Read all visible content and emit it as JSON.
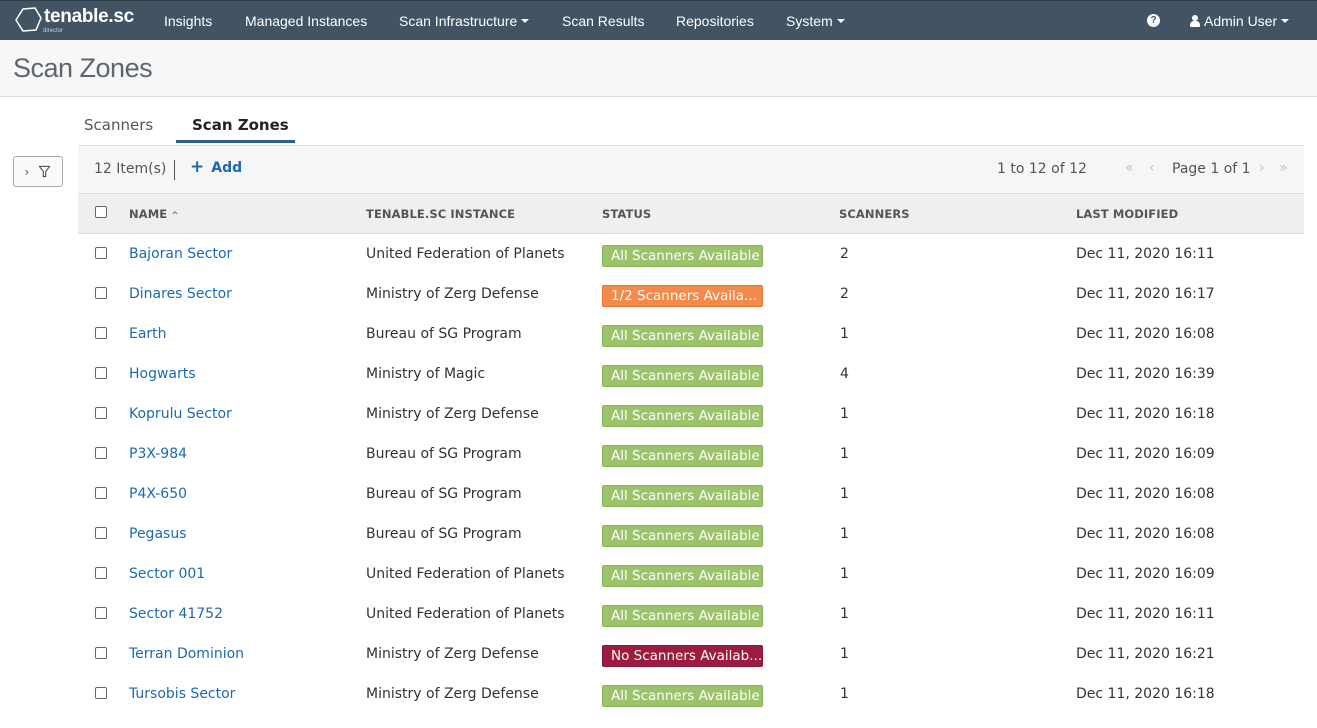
{
  "app": {
    "logo_text": "tenable.sc",
    "logo_sub": "director"
  },
  "nav": {
    "items": [
      {
        "label": "Insights",
        "dropdown": false
      },
      {
        "label": "Managed Instances",
        "dropdown": false
      },
      {
        "label": "Scan Infrastructure",
        "dropdown": true
      },
      {
        "label": "Scan Results",
        "dropdown": false
      },
      {
        "label": "Repositories",
        "dropdown": false
      },
      {
        "label": "System",
        "dropdown": true
      }
    ],
    "help_icon": "?",
    "user_label": "Admin User"
  },
  "page": {
    "title": "Scan Zones"
  },
  "tabs": [
    {
      "label": "Scanners",
      "active": false
    },
    {
      "label": "Scan Zones",
      "active": true
    }
  ],
  "toolbar": {
    "item_count": "12 Item(s)",
    "add_label": "Add",
    "add_icon": "+",
    "range": "1 to 12 of 12",
    "first_icon": "«",
    "prev_icon": "‹",
    "page_label": "Page 1 of 1",
    "next_icon": "›",
    "last_icon": "»"
  },
  "table": {
    "columns": [
      "NAME",
      "TENABLE.SC INSTANCE",
      "STATUS",
      "SCANNERS",
      "LAST MODIFIED"
    ],
    "sort_indicator": "^",
    "status_colors": {
      "all": "#9cc26b",
      "partial": "#f3894a",
      "none": "#9b1c3f"
    },
    "rows": [
      {
        "name": "Bajoran Sector",
        "instance": "United Federation of Planets",
        "status": "All Scanners Available",
        "status_type": "all",
        "scanners": "2",
        "modified": "Dec 11, 2020 16:11"
      },
      {
        "name": "Dinares Sector",
        "instance": "Ministry of Zerg Defense",
        "status": "1/2 Scanners Availa...",
        "status_type": "partial",
        "scanners": "2",
        "modified": "Dec 11, 2020 16:17"
      },
      {
        "name": "Earth",
        "instance": "Bureau of SG Program",
        "status": "All Scanners Available",
        "status_type": "all",
        "scanners": "1",
        "modified": "Dec 11, 2020 16:08"
      },
      {
        "name": "Hogwarts",
        "instance": "Ministry of Magic",
        "status": "All Scanners Available",
        "status_type": "all",
        "scanners": "4",
        "modified": "Dec 11, 2020 16:39"
      },
      {
        "name": "Koprulu Sector",
        "instance": "Ministry of Zerg Defense",
        "status": "All Scanners Available",
        "status_type": "all",
        "scanners": "1",
        "modified": "Dec 11, 2020 16:18"
      },
      {
        "name": "P3X-984",
        "instance": "Bureau of SG Program",
        "status": "All Scanners Available",
        "status_type": "all",
        "scanners": "1",
        "modified": "Dec 11, 2020 16:09"
      },
      {
        "name": "P4X-650",
        "instance": "Bureau of SG Program",
        "status": "All Scanners Available",
        "status_type": "all",
        "scanners": "1",
        "modified": "Dec 11, 2020 16:08"
      },
      {
        "name": "Pegasus",
        "instance": "Bureau of SG Program",
        "status": "All Scanners Available",
        "status_type": "all",
        "scanners": "1",
        "modified": "Dec 11, 2020 16:08"
      },
      {
        "name": "Sector 001",
        "instance": "United Federation of Planets",
        "status": "All Scanners Available",
        "status_type": "all",
        "scanners": "1",
        "modified": "Dec 11, 2020 16:09"
      },
      {
        "name": "Sector 41752",
        "instance": "United Federation of Planets",
        "status": "All Scanners Available",
        "status_type": "all",
        "scanners": "1",
        "modified": "Dec 11, 2020 16:11"
      },
      {
        "name": "Terran Dominion",
        "instance": "Ministry of Zerg Defense",
        "status": "No Scanners Availab...",
        "status_type": "none",
        "scanners": "1",
        "modified": "Dec 11, 2020 16:21"
      },
      {
        "name": "Tursobis Sector",
        "instance": "Ministry of Zerg Defense",
        "status": "All Scanners Available",
        "status_type": "all",
        "scanners": "1",
        "modified": "Dec 11, 2020 16:18"
      }
    ]
  }
}
